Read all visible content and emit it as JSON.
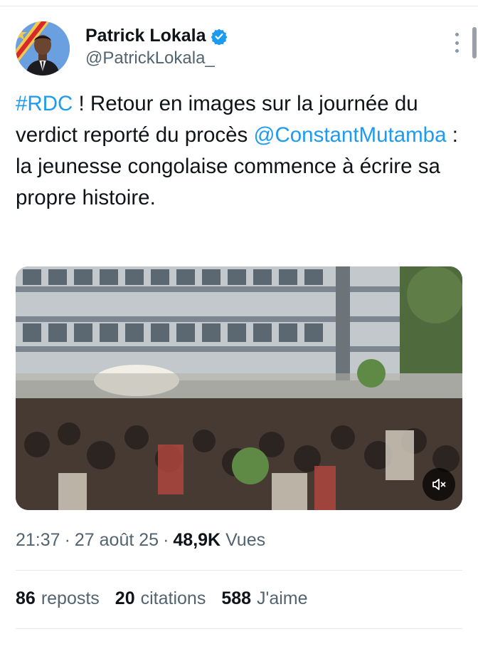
{
  "author": {
    "display_name": "Patrick Lokala",
    "handle": "@PatrickLokala_",
    "verified": true,
    "avatar_icon": "profile-photo"
  },
  "tweet": {
    "hashtag": "#RDC",
    "part1": " ! Retour en images sur la journée du verdict reporté du procès ",
    "mention": "@ConstantMutamba",
    "part2": " : la jeunesse congolaise commence à écrire sa propre histoire."
  },
  "media": {
    "type": "video",
    "mute_icon": "speaker-muted-icon"
  },
  "meta": {
    "time": "21:37",
    "date": "27 août 25",
    "views_count": "48,9K",
    "views_label": "Vues"
  },
  "stats": {
    "reposts_count": "86",
    "reposts_label": "reposts",
    "quotes_count": "20",
    "quotes_label": "citations",
    "likes_count": "588",
    "likes_label": "J'aime"
  },
  "colors": {
    "link": "#1d9bf0",
    "text": "#0f1419",
    "secondary": "#536471",
    "divider": "#e6e9ec"
  }
}
